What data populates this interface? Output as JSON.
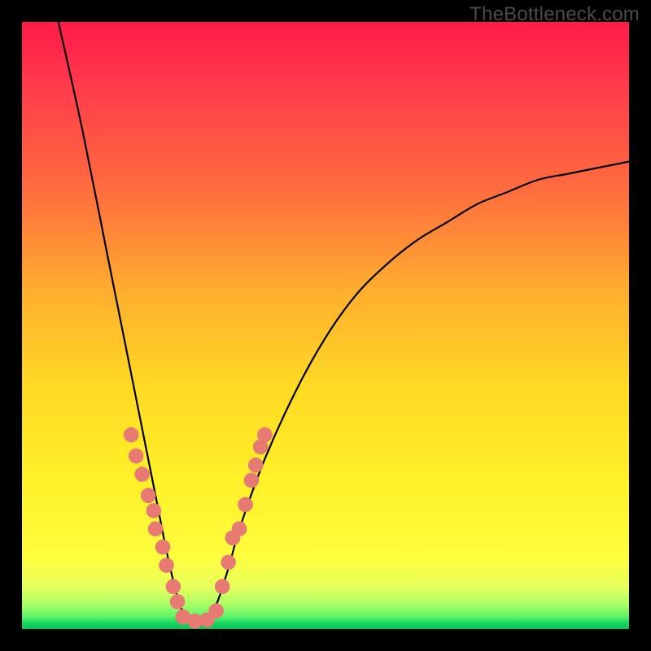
{
  "watermark": "TheBottleneck.com",
  "chart_data": {
    "type": "line",
    "title": "",
    "xlabel": "",
    "ylabel": "",
    "xlim": [
      0,
      100
    ],
    "ylim": [
      0,
      100
    ],
    "grid": false,
    "legend": false,
    "series": [
      {
        "name": "bottleneck-curve",
        "comment": "x = horizontal position (percent of plot width), y = vertical position (percent of plot height, 0 at top). Curve descends steeply from x≈6 to a flat minimum around x≈26–32, then rises with decreasing slope toward the right edge.",
        "x": [
          6,
          10,
          14,
          18,
          22,
          24,
          26,
          28,
          30,
          32,
          34,
          36,
          40,
          45,
          50,
          55,
          60,
          65,
          70,
          75,
          80,
          85,
          90,
          95,
          100
        ],
        "y": [
          0,
          18,
          38,
          58,
          78,
          88,
          96,
          99,
          99,
          96,
          90,
          83,
          72,
          61,
          52,
          45,
          40,
          36,
          33,
          30,
          28,
          26,
          25,
          24,
          23
        ]
      }
    ],
    "beads": {
      "comment": "Salmon circular markers clustered on the lower portions of the V.",
      "left": [
        {
          "x": 18.0,
          "y": 68.0
        },
        {
          "x": 18.8,
          "y": 71.5
        },
        {
          "x": 19.8,
          "y": 74.5
        },
        {
          "x": 20.8,
          "y": 78.0
        },
        {
          "x": 21.7,
          "y": 80.5
        },
        {
          "x": 22.0,
          "y": 83.5
        },
        {
          "x": 23.2,
          "y": 86.5
        },
        {
          "x": 23.8,
          "y": 89.5
        },
        {
          "x": 24.9,
          "y": 93.0
        },
        {
          "x": 25.6,
          "y": 95.5
        }
      ],
      "bottom": [
        {
          "x": 26.5,
          "y": 98.0
        },
        {
          "x": 28.5,
          "y": 98.7
        },
        {
          "x": 30.5,
          "y": 98.5
        },
        {
          "x": 32.0,
          "y": 97.0
        }
      ],
      "right": [
        {
          "x": 33.0,
          "y": 93.0
        },
        {
          "x": 34.0,
          "y": 89.0
        },
        {
          "x": 34.7,
          "y": 85.0
        },
        {
          "x": 35.8,
          "y": 83.5
        },
        {
          "x": 36.8,
          "y": 79.5
        },
        {
          "x": 37.8,
          "y": 75.5
        },
        {
          "x": 38.5,
          "y": 73.0
        },
        {
          "x": 39.3,
          "y": 70.0
        },
        {
          "x": 40.0,
          "y": 68.0
        }
      ],
      "radius_pct": 1.25
    },
    "colors": {
      "curve": "#000000",
      "bead": "#e77a72",
      "gradient_top": "#ff1a49",
      "gradient_mid": "#fff028",
      "gradient_bottom": "#0dc35a",
      "frame": "#000000",
      "watermark": "#4b4b4b"
    }
  }
}
